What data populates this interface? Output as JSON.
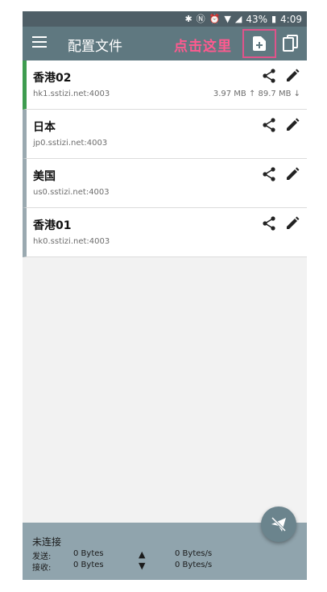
{
  "status_bar": {
    "battery": "43%",
    "time": "4:09"
  },
  "app_bar": {
    "title": "配置文件",
    "hint": "点击这里"
  },
  "profiles": [
    {
      "name": "香港02",
      "host": "hk1.sstizi.net:4003",
      "traffic": "3.97 MB ↑ 89.7 MB ↓",
      "active": true
    },
    {
      "name": "日本",
      "host": "jp0.sstizi.net:4003",
      "traffic": ""
    },
    {
      "name": "美国",
      "host": "us0.sstizi.net:4003",
      "traffic": ""
    },
    {
      "name": "香港01",
      "host": "hk0.sstizi.net:4003",
      "traffic": ""
    }
  ],
  "footer": {
    "status": "未连接",
    "send_label": "发送:",
    "send_total": "0 Bytes",
    "send_rate": "0 Bytes/s",
    "recv_label": "接收:",
    "recv_total": "0 Bytes",
    "recv_rate": "0 Bytes/s"
  },
  "colors": {
    "app_bar": "#5f7880",
    "active_indicator": "#3e9c4f",
    "hint": "#ff5a8f",
    "footer": "#90a4ad"
  }
}
